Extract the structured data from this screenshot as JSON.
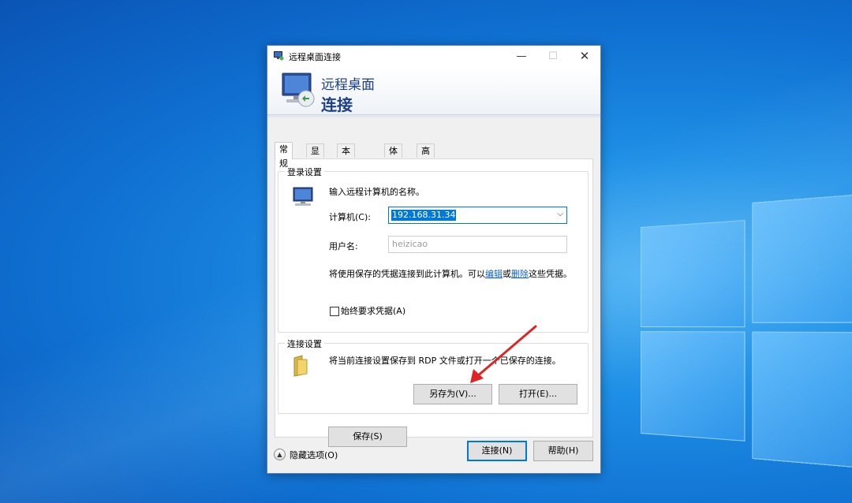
{
  "window": {
    "title": "远程桌面连接",
    "controls": {
      "minimize": "—",
      "maximize": "☐",
      "close": "✕"
    }
  },
  "banner": {
    "line1": "远程桌面",
    "line2": "连接"
  },
  "tabs": [
    {
      "label": "常规",
      "active": true
    },
    {
      "label": "显示",
      "active": false
    },
    {
      "label": "本地资源",
      "active": false
    },
    {
      "label": "体验",
      "active": false
    },
    {
      "label": "高级",
      "active": false
    }
  ],
  "login_settings": {
    "group_label": "登录设置",
    "prompt": "输入远程计算机的名称。",
    "computer_label": "计算机(C):",
    "computer_value": "192.168.31.34",
    "username_label": "用户名:",
    "username_value": "heizicao",
    "saved_text_pre": "将使用保存的凭据连接到此计算机。可以",
    "saved_link_edit": "编辑",
    "saved_text_mid": "或",
    "saved_link_delete": "删除",
    "saved_text_post": "这些凭据。",
    "always_ask_label": "始终要求凭据(A)"
  },
  "connection_settings": {
    "group_label": "连接设置",
    "description": "将当前连接设置保存到 RDP 文件或打开一个已保存的连接。",
    "save_button": "保存(S)",
    "save_as_button": "另存为(V)...",
    "open_button": "打开(E)..."
  },
  "footer": {
    "hide_options": "隐藏选项(O)",
    "connect_button": "连接(N)",
    "help_button": "帮助(H)"
  },
  "colors": {
    "accent": "#0078d7",
    "annotation_arrow": "#e02424",
    "banner_text": "#1b3f8a"
  }
}
